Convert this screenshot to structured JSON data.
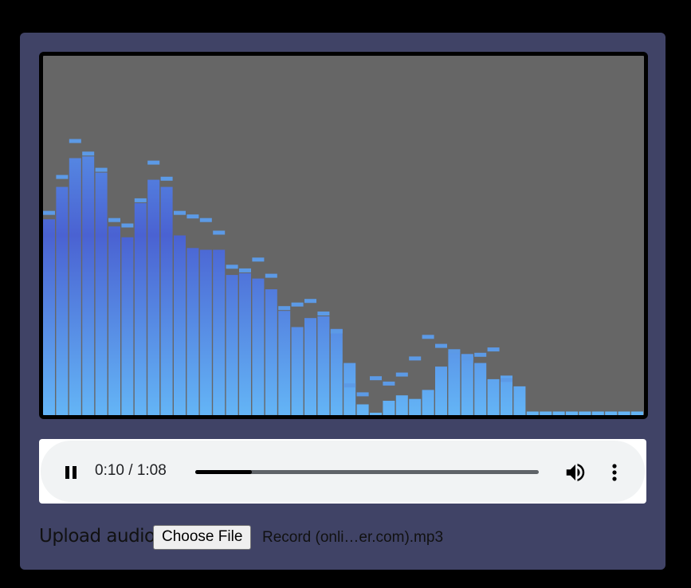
{
  "visualizer": {
    "levels": [
      0.545,
      0.635,
      0.715,
      0.72,
      0.675,
      0.525,
      0.495,
      0.59,
      0.655,
      0.635,
      0.5,
      0.465,
      0.46,
      0.46,
      0.39,
      0.395,
      0.38,
      0.35,
      0.29,
      0.245,
      0.27,
      0.275,
      0.24,
      0.145,
      0.03,
      0.005,
      0.04,
      0.055,
      0.045,
      0.07,
      0.135,
      0.175,
      0.17,
      0.145,
      0.1,
      0.11,
      0.08,
      0.01,
      0.01,
      0.01,
      0.01,
      0.01,
      0.01,
      0.01,
      0.01,
      0.01
    ],
    "peaks": [
      0.555,
      0.655,
      0.755,
      0.72,
      0.675,
      0.535,
      0.52,
      0.59,
      0.695,
      0.65,
      0.555,
      0.545,
      0.535,
      0.5,
      0.405,
      0.395,
      0.425,
      0.38,
      0.29,
      0.3,
      0.31,
      0.275,
      0.225,
      0.075,
      0.05,
      0.095,
      0.08,
      0.105,
      0.15,
      0.21,
      0.185,
      0.17,
      0.15,
      0.16,
      0.175,
      0.09,
      0.01,
      0.01,
      0.01,
      0.01,
      0.01,
      0.01,
      0.01,
      0.01,
      0.01,
      0.01
    ],
    "colors": {
      "bar_edge": "#64b5f6",
      "bar_mid": "#4a62d2",
      "peak": "#5c9ae6",
      "background": "#666666"
    }
  },
  "player": {
    "time_display": "0:10 / 1:08",
    "progress_fraction": 0.165,
    "is_playing": true,
    "pause_icon": "pause-icon",
    "volume_icon": "volume-icon",
    "menu_icon": "more-vert-icon"
  },
  "upload": {
    "label": "Upload audio",
    "button_label": "Choose File",
    "file_name": "Record (onli…er.com).mp3"
  }
}
